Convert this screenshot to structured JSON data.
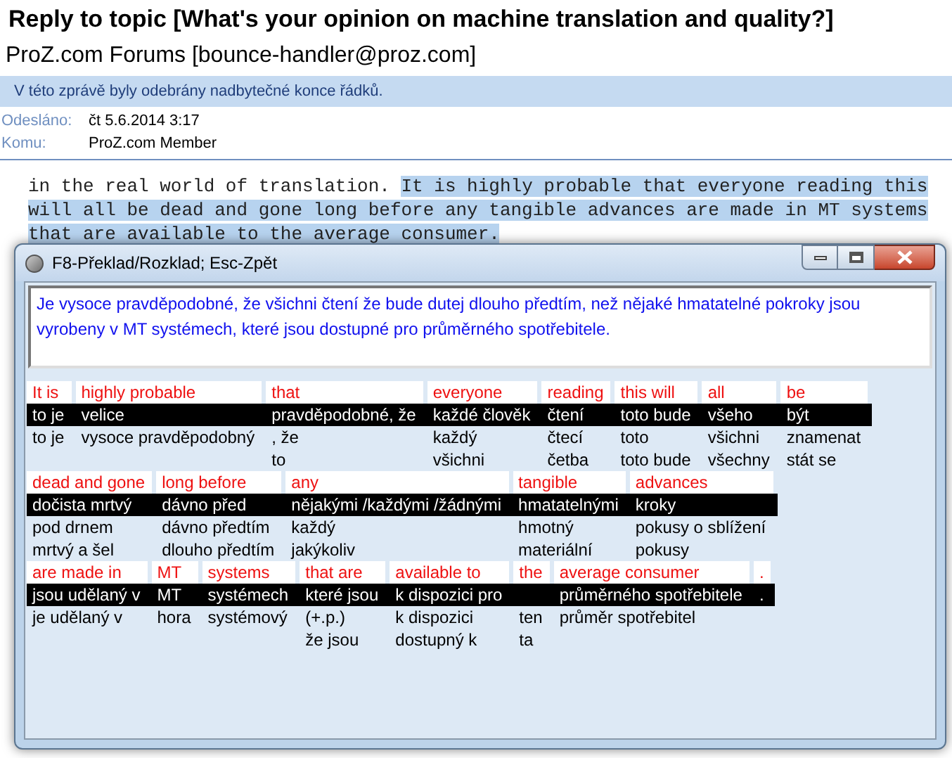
{
  "message": {
    "subject": "Reply to topic [What's your opinion on machine translation and quality?]",
    "sender": "ProZ.com Forums [bounce-handler@proz.com]",
    "info_bar": "V této zprávě byly odebrány nadbytečné konce řádků.",
    "fields": [
      {
        "label": "Odesláno:",
        "value": "čt 5.6.2014 3:17"
      },
      {
        "label": "Komu:",
        "value": "ProZ.com Member"
      }
    ],
    "body_lines": [
      [
        {
          "text": "in the real world of translation. ",
          "highlighted": false
        },
        {
          "text": "It is highly probable that everyone reading this",
          "highlighted": true
        }
      ],
      [
        {
          "text": "will all be dead and gone long before any tangible advances are made in MT systems",
          "highlighted": true
        }
      ],
      [
        {
          "text": "that are available to the average consumer.",
          "highlighted": true
        }
      ]
    ]
  },
  "dialog": {
    "title": "F8-Překlad/Rozklad; Esc-Zpět",
    "translation": "Je vysoce pravděpodobné, že všichni čtení že bude dutej dlouho předtím, než nějaké hmatatelné pokroky jsou vyrobeny v MT systémech, které jsou dostupné pro průměrného spotřebitele.",
    "lines": [
      [
        {
          "source": "It is",
          "primary": "to je",
          "alternatives": [
            "to je"
          ]
        },
        {
          "source": "highly probable",
          "primary": "velice",
          "alternatives": [
            "vysoce pravděpodobný"
          ]
        },
        {
          "source": "that",
          "primary": "pravděpodobné, že",
          "alternatives": [
            ", že",
            "to"
          ]
        },
        {
          "source": "everyone",
          "primary": "každé člověk",
          "alternatives": [
            "každý",
            "všichni"
          ]
        },
        {
          "source": "reading",
          "primary": "čtení",
          "alternatives": [
            "čtecí",
            "četba"
          ]
        },
        {
          "source": "this will",
          "primary": "toto bude",
          "alternatives": [
            "toto",
            "toto bude"
          ]
        },
        {
          "source": "all",
          "primary": "všeho",
          "alternatives": [
            "všichni",
            "všechny"
          ]
        },
        {
          "source": "be",
          "primary": "být",
          "alternatives": [
            "znamenat",
            "stát se"
          ]
        }
      ],
      [
        {
          "source": "dead and gone",
          "primary": "dočista mrtvý",
          "alternatives": [
            "pod drnem",
            "mrtvý a šel"
          ]
        },
        {
          "source": "long before",
          "primary": "dávno před",
          "alternatives": [
            "dávno předtím",
            "dlouho předtím"
          ]
        },
        {
          "source": "any",
          "primary": "nějakými /každými /žádnými",
          "alternatives": [
            "každý",
            "jakýkoliv"
          ]
        },
        {
          "source": "tangible",
          "primary": "hmatatelnými",
          "alternatives": [
            "hmotný",
            "materiální"
          ]
        },
        {
          "source": "advances",
          "primary": "kroky",
          "alternatives": [
            "pokusy o sblížení",
            "pokusy"
          ]
        }
      ],
      [
        {
          "source": "are made in",
          "primary": "jsou udělaný v",
          "alternatives": [
            "je udělaný v"
          ]
        },
        {
          "source": "MT",
          "primary": "MT",
          "alternatives": [
            "hora"
          ]
        },
        {
          "source": "systems",
          "primary": "systémech",
          "alternatives": [
            "systémový"
          ]
        },
        {
          "source": "that are",
          "primary": "které jsou",
          "alternatives": [
            "(+.p.)",
            "že jsou"
          ]
        },
        {
          "source": "available to",
          "primary": "k dispozici pro",
          "alternatives": [
            "k dispozici",
            "dostupný k"
          ]
        },
        {
          "source": "the",
          "alternatives": [
            "ten",
            "ta"
          ]
        },
        {
          "source": "average consumer",
          "primary": "průměrného spotřebitele",
          "alternatives": [
            "průměr spotřebitel"
          ]
        },
        {
          "source": ".",
          "primary": "."
        }
      ]
    ]
  }
}
